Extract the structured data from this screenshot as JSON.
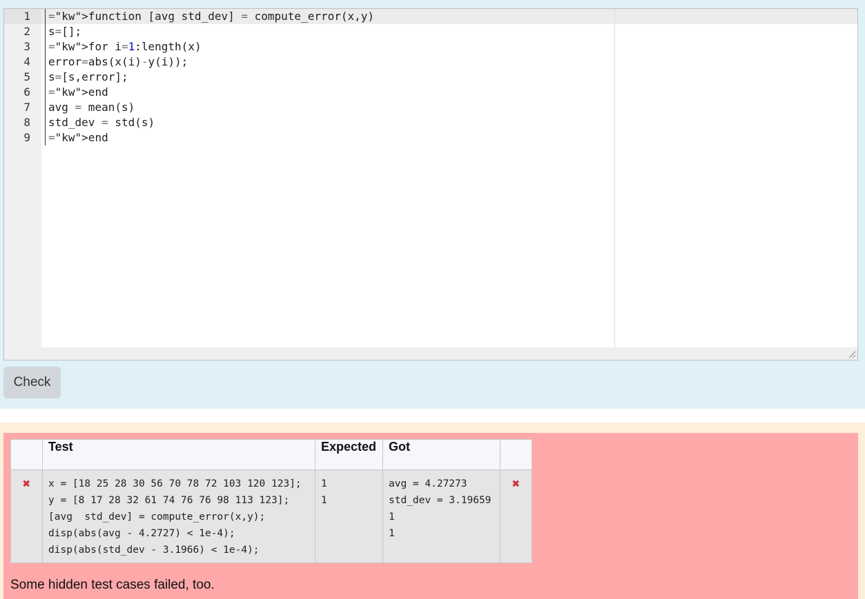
{
  "editor": {
    "line_numbers": [
      "1",
      "2",
      "3",
      "4",
      "5",
      "6",
      "7",
      "8",
      "9"
    ],
    "lines": [
      "function [avg std_dev] = compute_error(x,y)",
      "s=[];",
      "for i=1:length(x)",
      "error=abs(x(i)-y(i));",
      "s=[s,error];",
      "end",
      "avg = mean(s)",
      "std_dev = std(s)",
      "end"
    ]
  },
  "actions": {
    "check_label": "Check"
  },
  "results": {
    "headers": {
      "icon": "",
      "test": "Test",
      "expected": "Expected",
      "got": "Got",
      "status": ""
    },
    "rows": [
      {
        "icon": "✖",
        "test_lines": [
          "x = [18 25 28 30 56 70 78 72 103 120 123];",
          "y = [8 17 28 32 61 74 76 76 98 113 123];",
          "[avg  std_dev] = compute_error(x,y);",
          "disp(abs(avg - 4.2727) < 1e-4);",
          "disp(abs(std_dev - 3.1966) < 1e-4);"
        ],
        "expected_lines": [
          "1",
          "1"
        ],
        "got_lines": [
          "avg = 4.27273",
          "std_dev = 3.19659",
          "1",
          "1"
        ],
        "status_icon": "✖"
      }
    ],
    "hidden_message": "Some hidden test cases failed, too."
  },
  "colors": {
    "answer_bg": "#dff0f7",
    "result_bg": "#fea8aa",
    "fail_icon": "#d0323a"
  }
}
